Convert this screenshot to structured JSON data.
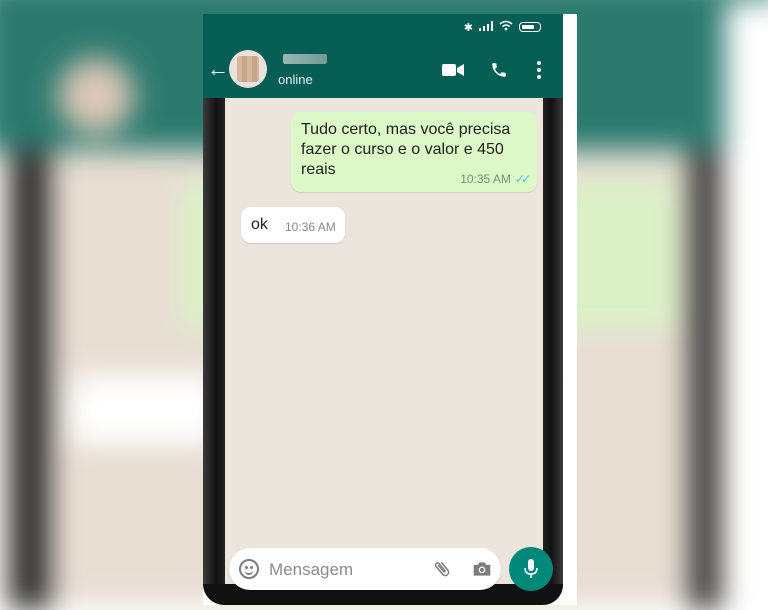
{
  "header": {
    "status": "online"
  },
  "messages": [
    {
      "direction": "outgoing",
      "text": "Tudo certo, mas você precisa fazer o curso e o valor e 450 reais",
      "time": "10:35 AM",
      "read": true
    },
    {
      "direction": "incoming",
      "text": "ok",
      "time": "10:36 AM"
    }
  ],
  "input": {
    "placeholder": "Mensagem"
  },
  "icons": {
    "back": "back-arrow-icon",
    "video": "video-call-icon",
    "call": "phone-call-icon",
    "menu": "more-vert-icon",
    "emoji": "emoji-icon",
    "attach": "paperclip-icon",
    "camera": "camera-icon",
    "mic": "microphone-icon"
  },
  "colors": {
    "header": "#075e54",
    "outgoing_bubble": "#dcf8c6",
    "incoming_bubble": "#ffffff",
    "chat_background": "#ece5dd",
    "mic_button": "#00897b",
    "read_ticks": "#4fc3f7"
  }
}
